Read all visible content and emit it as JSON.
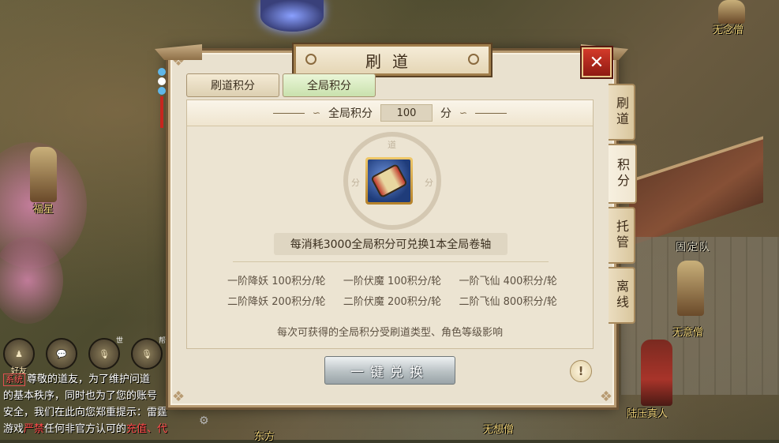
{
  "dialog": {
    "title": "刷道",
    "close_symbol": "✕",
    "top_tabs": [
      {
        "label": "刷道积分",
        "active": false
      },
      {
        "label": "全局积分",
        "active": true
      }
    ],
    "side_tabs": [
      {
        "label": "刷道",
        "active": false
      },
      {
        "label": "积分",
        "active": true
      },
      {
        "label": "托管",
        "active": false
      },
      {
        "label": "离线",
        "active": false
      }
    ],
    "points": {
      "label": "全局积分",
      "value": "100",
      "unit": "分"
    },
    "emblem_glyphs": [
      "道",
      "分",
      "分"
    ],
    "item_icon": "blue-scroll-icon",
    "exchange_note": "每消耗3000全局积分可兑换1本全局卷轴",
    "rates": [
      "一阶降妖 100积分/轮",
      "一阶伏魔 100积分/轮",
      "一阶飞仙 400积分/轮",
      "二阶降妖 200积分/轮",
      "二阶伏魔 200积分/轮",
      "二阶飞仙 800积分/轮"
    ],
    "footnote": "每次可获得的全局积分受刷道类型、角色等级影响",
    "action_button": "一键兑换",
    "info_symbol": "!"
  },
  "scene": {
    "npc_names": {
      "top_right": "无念僧",
      "left": "福星",
      "team": "固定队",
      "right_mid": "无意僧",
      "bottom_right": "陆压真人",
      "bottom_mid": "无想僧",
      "bottom_left": "东方"
    }
  },
  "hud": {
    "friends_label": "好友",
    "chat_icon": "chat-bubble-icon",
    "mic_world_label": "世",
    "mic_gang_label": "帮"
  },
  "chat": {
    "tag": "系统",
    "line1": "尊敬的道友，为了维护问道",
    "line2": "的基本秩序，同时也为了您的账号",
    "line3": "安全，我们在此向您郑重提示：雷霆",
    "line4_a": "游戏",
    "line4_b": "严禁",
    "line4_c": "任何非官方认可的",
    "line4_d": "充值",
    "line4_e": "、代"
  }
}
